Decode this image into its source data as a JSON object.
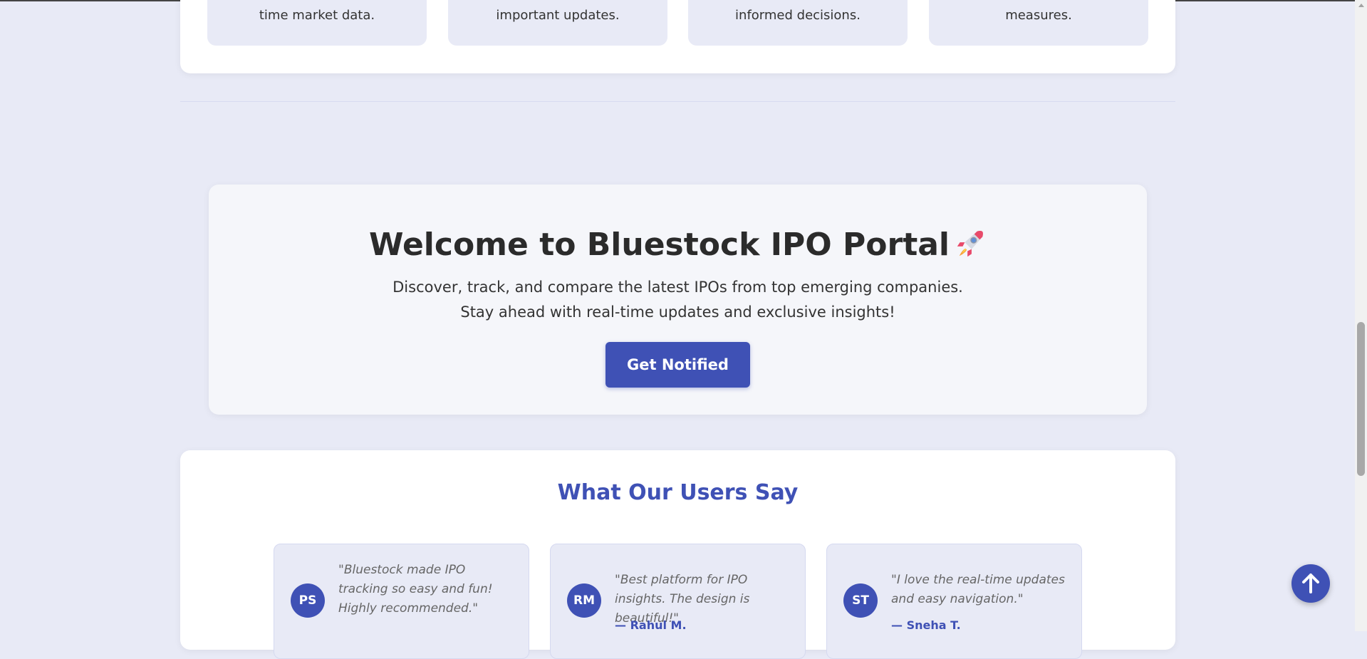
{
  "features": {
    "tiles": [
      {
        "text": "time market data."
      },
      {
        "text": "important updates."
      },
      {
        "text": "informed decisions."
      },
      {
        "text": "measures."
      }
    ]
  },
  "hero": {
    "title": "Welcome to Bluestock IPO Portal",
    "title_icon": "rocket-icon",
    "subtitle": "Discover, track, and compare the latest IPOs from top emerging companies. Stay ahead with real-time updates and exclusive insights!",
    "button_label": "Get Notified"
  },
  "testimonials": {
    "title": "What Our Users Say",
    "items": [
      {
        "initials": "PS",
        "quote": "\"Bluestock made IPO tracking so easy and fun! Highly recommended.\"",
        "author": ""
      },
      {
        "initials": "RM",
        "quote": "\"Best platform for IPO insights. The design is beautiful!\"",
        "author": "— Rahul M."
      },
      {
        "initials": "ST",
        "quote": "\"I love the real-time updates and easy navigation.\"",
        "author": "— Sneha T."
      }
    ]
  },
  "scroll_top": {
    "icon": "arrow-up-icon"
  },
  "colors": {
    "accent": "#3f51b5",
    "page_bg": "#e8eaf6",
    "card_bg": "#ffffff",
    "hero_bg": "#f5f6fa"
  }
}
